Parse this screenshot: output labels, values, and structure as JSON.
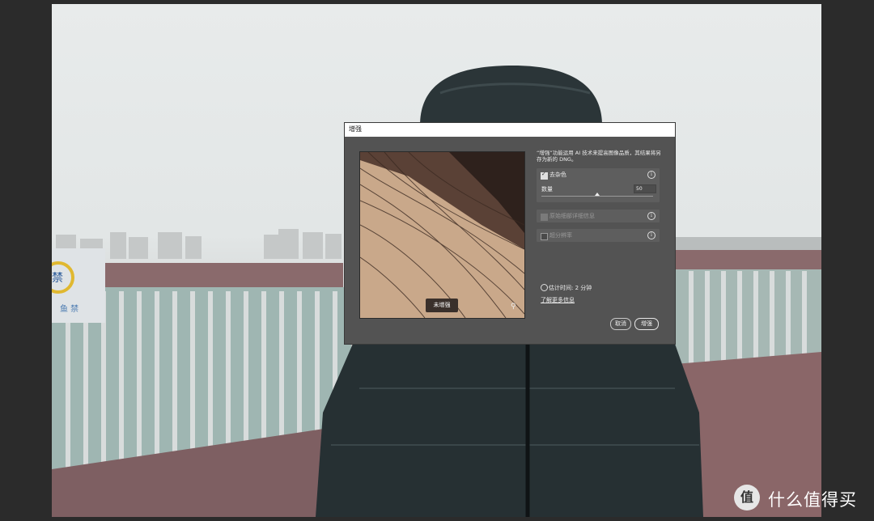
{
  "dialog": {
    "title": "增强",
    "description": "“增强”功能运用 AI 技术来提高图像品质，其结果将另存为新的 DNG。",
    "preview_badge": "未增强",
    "options": [
      {
        "label": "去杂色",
        "checked": true,
        "enabled": true
      },
      {
        "label": "原始细部详细信息",
        "checked": true,
        "enabled": false
      },
      {
        "label": "超分辨率",
        "checked": false,
        "enabled": false
      }
    ],
    "amount_label": "数量",
    "amount_value": "50",
    "amount_fraction": 0.5,
    "estimate": "估计时间: 2 分钟",
    "learn_more": "了解更多信息",
    "cancel": "取消",
    "enhance": "增强"
  },
  "scene": {
    "sign_text": "禁",
    "sign_sub": "鱼 禁"
  },
  "watermark": {
    "logo": "值",
    "text": "什么值得买"
  },
  "icons": {
    "info": "info-icon",
    "zoom": "magnifier-icon",
    "timer": "stopwatch-icon",
    "check": "checkbox-icon"
  }
}
